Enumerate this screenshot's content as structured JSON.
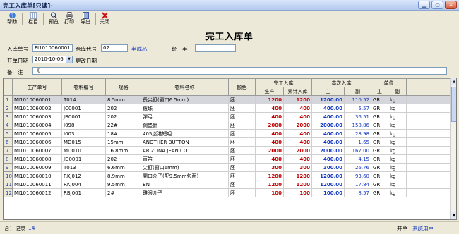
{
  "window": {
    "title": "完工入库单[只读]-"
  },
  "toolbar": [
    {
      "label": "帮助",
      "icon": "help-icon"
    },
    {
      "label": "栏目",
      "icon": "columns-icon"
    },
    {
      "label": "预览",
      "icon": "preview-icon"
    },
    {
      "label": "打印",
      "icon": "print-icon"
    },
    {
      "label": "导出",
      "icon": "export-icon"
    },
    {
      "label": "关闭",
      "icon": "close-icon"
    }
  ],
  "doc_title": "完工入库单",
  "form": {
    "order_no_label": "入库单号",
    "order_no": "FI1010060001",
    "warehouse_label": "仓库代号",
    "warehouse": "02",
    "warehouse_name": "半成品",
    "handler_label": "经　手",
    "handler": "",
    "date_label": "开单日期",
    "date": "2010-10-06",
    "modify_date_label": "更改日期",
    "remark_label": "备　注",
    "remark": "《"
  },
  "grid": {
    "headers": {
      "prod_no": "生产单号",
      "item_code": "物料编号",
      "spec": "规格",
      "item_name": "物料名称",
      "color": "颜色",
      "done_group": "完工入库",
      "produce": "生产",
      "cum": "累计入库",
      "this_group": "本次入库",
      "main": "主",
      "sub": "副",
      "unit_group": "单位",
      "u_main": "主",
      "u_sub": "副"
    },
    "rows": [
      {
        "n": "1",
        "prod": "MI1010060001",
        "code": "T014",
        "spec": "8.5mm",
        "name": "長尖釘(窗口6.5mm)",
        "color": "胚",
        "produce": "1200",
        "cum": "1200",
        "main": "1200.00",
        "sub": "110.52",
        "um": "GR",
        "us": "kg"
      },
      {
        "n": "2",
        "prod": "MI1010060002",
        "code": "JC0001",
        "spec": "202",
        "name": "鈕珠",
        "color": "胚",
        "produce": "400",
        "cum": "400",
        "main": "400.00",
        "sub": "5.57",
        "um": "GR",
        "us": "kg"
      },
      {
        "n": "3",
        "prod": "MI1010060003",
        "code": "JB0001",
        "spec": "202",
        "name": "彈弓",
        "color": "胚",
        "produce": "400",
        "cum": "400",
        "main": "400.00",
        "sub": "36.51",
        "um": "GR",
        "us": "kg"
      },
      {
        "n": "4",
        "prod": "MI1010060004",
        "code": "I098",
        "spec": "22#",
        "name": "鋼墊針",
        "color": "胚",
        "produce": "2000",
        "cum": "2000",
        "main": "2000.00",
        "sub": "158.86",
        "um": "GR",
        "us": "kg"
      },
      {
        "n": "5",
        "prod": "MI1010060005",
        "code": "I003",
        "spec": "18#",
        "name": "405迷港短咀",
        "color": "胚",
        "produce": "400",
        "cum": "400",
        "main": "400.00",
        "sub": "28.98",
        "um": "GR",
        "us": "kg"
      },
      {
        "n": "6",
        "prod": "MI1010060006",
        "code": "MD015",
        "spec": "15mm",
        "name": "ANOTHER BUTTON",
        "color": "胚",
        "produce": "400",
        "cum": "400",
        "main": "400.00",
        "sub": "1.65",
        "um": "GR",
        "us": "kg"
      },
      {
        "n": "7",
        "prod": "MI1010060007",
        "code": "MD010",
        "spec": "16.8mm",
        "name": "ARIZONA JEAN CO.",
        "color": "胚",
        "produce": "2000",
        "cum": "2000",
        "main": "2000.00",
        "sub": "167.00",
        "um": "GR",
        "us": "kg"
      },
      {
        "n": "8",
        "prod": "MI1010060008",
        "code": "JD0001",
        "spec": "202",
        "name": "直笛",
        "color": "胚",
        "produce": "400",
        "cum": "400",
        "main": "400.00",
        "sub": "4.15",
        "um": "GR",
        "us": "kg"
      },
      {
        "n": "9",
        "prod": "MI1010060009",
        "code": "T013",
        "spec": "6.6mm",
        "name": "尖釘(窗口6mm)",
        "color": "胚",
        "produce": "300",
        "cum": "300",
        "main": "300.00",
        "sub": "26.76",
        "um": "GR",
        "us": "kg"
      },
      {
        "n": "10",
        "prod": "MI1010060010",
        "code": "RKJ012",
        "spec": "8.9mm",
        "name": "開口介子(配9.5mm包面)",
        "color": "胚",
        "produce": "1200",
        "cum": "1200",
        "main": "1200.00",
        "sub": "93.60",
        "um": "GR",
        "us": "kg"
      },
      {
        "n": "11",
        "prod": "MI1010060011",
        "code": "RKJ004",
        "spec": "9.5mm",
        "name": "BN",
        "color": "胚",
        "produce": "1200",
        "cum": "1200",
        "main": "1200.00",
        "sub": "17.84",
        "um": "GR",
        "us": "kg"
      },
      {
        "n": "12",
        "prod": "MI1010060012",
        "code": "RBJ001",
        "spec": "2#",
        "name": "雞眼介子",
        "color": "胚",
        "produce": "100",
        "cum": "100",
        "main": "100.00",
        "sub": "8.57",
        "um": "GR",
        "us": "kg"
      }
    ]
  },
  "status": {
    "total_label": "合计记录:",
    "total": "14",
    "creator_label": "开单:",
    "creator": "系统用户"
  }
}
